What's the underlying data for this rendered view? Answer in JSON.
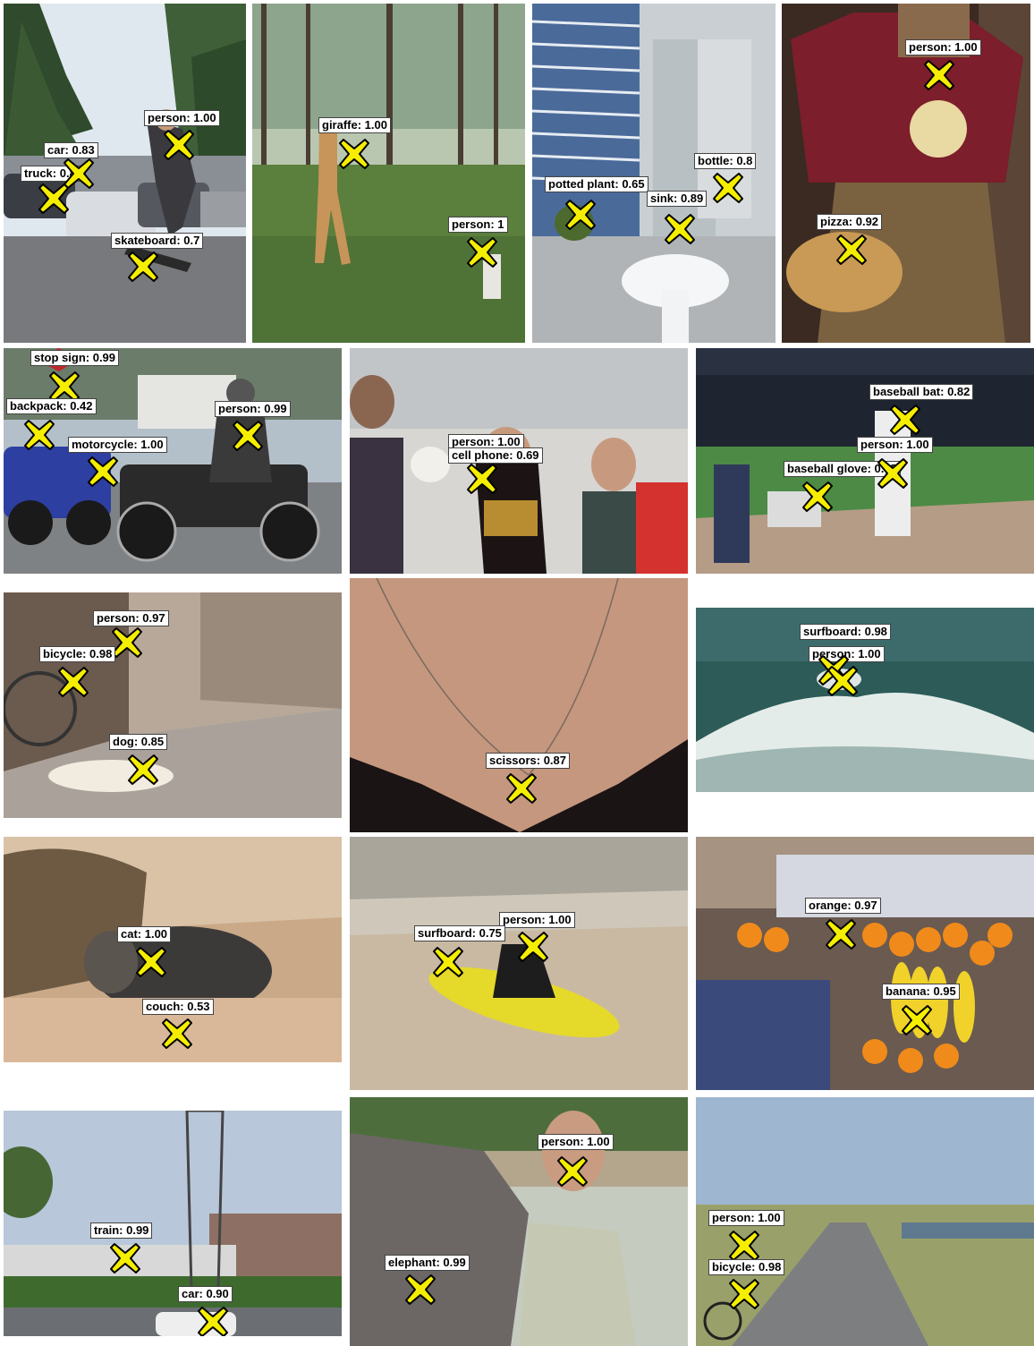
{
  "panels": [
    {
      "id": "p1",
      "detections": [
        {
          "label": "person: 1.00"
        },
        {
          "label": "car: 0.83"
        },
        {
          "label": "truck: 0.85"
        },
        {
          "label": "skateboard: 0.7"
        }
      ]
    },
    {
      "id": "p2",
      "detections": [
        {
          "label": "giraffe: 1.00"
        },
        {
          "label": "person: 1"
        }
      ]
    },
    {
      "id": "p3",
      "detections": [
        {
          "label": "potted plant: 0.65"
        },
        {
          "label": "sink: 0.89"
        },
        {
          "label": "bottle: 0.8"
        }
      ]
    },
    {
      "id": "p4",
      "detections": [
        {
          "label": "person: 1.00"
        },
        {
          "label": "pizza: 0.92"
        }
      ]
    },
    {
      "id": "p5",
      "detections": [
        {
          "label": "stop sign: 0.99"
        },
        {
          "label": "backpack: 0.42"
        },
        {
          "label": "person: 0.99"
        },
        {
          "label": "motorcycle: 1.00"
        }
      ]
    },
    {
      "id": "p6",
      "detections": [
        {
          "label": "person: 1.00"
        },
        {
          "label": "cell phone: 0.69"
        }
      ]
    },
    {
      "id": "p7",
      "detections": [
        {
          "label": "baseball bat: 0.82"
        },
        {
          "label": "person: 1.00"
        },
        {
          "label": "baseball glove: 0.95"
        }
      ]
    },
    {
      "id": "p8",
      "detections": [
        {
          "label": "person: 0.97"
        },
        {
          "label": "bicycle: 0.98"
        },
        {
          "label": "dog: 0.85"
        }
      ]
    },
    {
      "id": "p9",
      "detections": [
        {
          "label": "scissors: 0.87"
        }
      ]
    },
    {
      "id": "p10",
      "detections": [
        {
          "label": "surfboard: 0.98"
        },
        {
          "label": "person: 1.00"
        }
      ]
    },
    {
      "id": "p11",
      "detections": [
        {
          "label": "cat: 1.00"
        },
        {
          "label": "couch: 0.53"
        }
      ]
    },
    {
      "id": "p12",
      "detections": [
        {
          "label": "person: 1.00"
        },
        {
          "label": "surfboard: 0.75"
        }
      ]
    },
    {
      "id": "p13",
      "detections": [
        {
          "label": "orange: 0.97"
        },
        {
          "label": "banana: 0.95"
        }
      ]
    },
    {
      "id": "p14",
      "detections": [
        {
          "label": "train: 0.99"
        },
        {
          "label": "car: 0.90"
        }
      ]
    },
    {
      "id": "p15",
      "detections": [
        {
          "label": "person: 1.00"
        },
        {
          "label": "elephant: 0.99"
        }
      ]
    },
    {
      "id": "p16",
      "detections": [
        {
          "label": "person: 1.00"
        },
        {
          "label": "bicycle: 0.98"
        }
      ]
    }
  ],
  "marker_colors": {
    "fill": "#f5ee00",
    "stroke": "#000000"
  }
}
